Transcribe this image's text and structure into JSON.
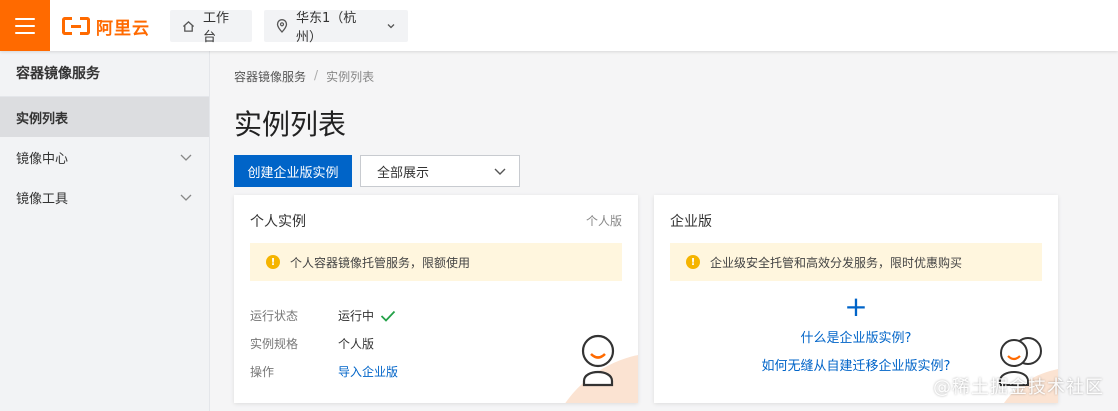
{
  "brand": {
    "name": "阿里云",
    "accent": "#ff6a00",
    "primary": "#0064c8"
  },
  "topbar": {
    "workbench_label": "工作台",
    "region_label": "华东1（杭州）"
  },
  "sidebar": {
    "title": "容器镜像服务",
    "items": [
      {
        "label": "实例列表",
        "active": true
      },
      {
        "label": "镜像中心",
        "expandable": true
      },
      {
        "label": "镜像工具",
        "expandable": true
      }
    ]
  },
  "breadcrumb": {
    "items": [
      "容器镜像服务",
      "实例列表"
    ],
    "separator": "/"
  },
  "page": {
    "title": "实例列表"
  },
  "toolbar": {
    "create_label": "创建企业版实例",
    "filter_value": "全部展示"
  },
  "personal_card": {
    "title": "个人实例",
    "tag": "个人版",
    "notice": "个人容器镜像托管服务，限额使用",
    "rows": [
      {
        "key": "运行状态",
        "value": "运行中"
      },
      {
        "key": "实例规格",
        "value": "个人版"
      },
      {
        "key": "操作",
        "value": "导入企业版"
      }
    ]
  },
  "enterprise_card": {
    "title": "企业版",
    "notice": "企业级安全托管和高效分发服务，限时优惠购买",
    "plus": "+",
    "link_1": "什么是企业版实例?",
    "link_2": "如何无缝从自建迁移企业版实例?"
  },
  "watermark": "@稀土掘金技术社区"
}
